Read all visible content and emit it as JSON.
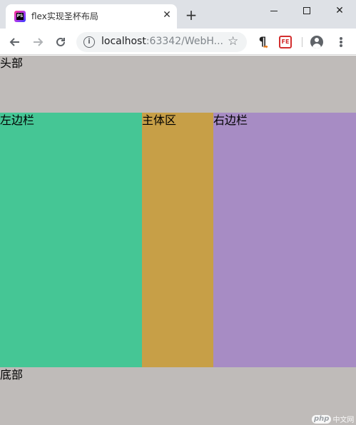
{
  "browser": {
    "tab_title": "flex实现圣杯布局",
    "favicon_text": "PS",
    "url_host": "localhost",
    "url_rest": ":63342/WebH...",
    "icons": {
      "back": "arrow-left-icon",
      "forward": "arrow-right-icon",
      "reload": "reload-icon",
      "info": "info-icon",
      "star": "star-icon",
      "extension_1": "pilcrow-icon",
      "extension_2": "fe-helper-icon",
      "profile": "profile-icon",
      "menu": "more-vertical-icon"
    },
    "fe_label": "FE"
  },
  "page": {
    "header_label": "头部",
    "left_label": "左边栏",
    "main_label": "主体区",
    "right_label": "右边栏",
    "footer_label": "底部",
    "colors": {
      "header": "#bfbbb9",
      "left": "#45c695",
      "main": "#c79f47",
      "right": "#a78cc4",
      "footer": "#bfbbb9"
    }
  },
  "watermark": {
    "badge": "php",
    "text": "中文网"
  }
}
